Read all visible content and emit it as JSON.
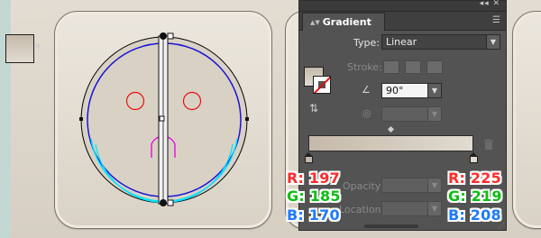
{
  "panel": {
    "title": "Gradient",
    "type_label": "Type:",
    "type_value": "Linear",
    "stroke_label": "Stroke:",
    "angle_value": "90°",
    "opacity_label": "Opacity:",
    "location_label": "Location:"
  },
  "gradient": {
    "start_color": "#c5b9aa",
    "end_color": "#e1dbd0"
  },
  "left_color": {
    "r_label": "R:",
    "r_value": "197",
    "g_label": "G:",
    "g_value": "185",
    "b_label": "B:",
    "b_value": "170"
  },
  "right_color": {
    "r_label": "R:",
    "r_value": "225",
    "g_label": "G:",
    "g_value": "219",
    "b_label": "B:",
    "b_value": "208"
  },
  "icons": {
    "collapse": "double-arrow-icon",
    "close": "close-icon",
    "menu": "panel-menu-icon",
    "angle": "angle-icon",
    "aspect": "aspect-ratio-icon",
    "reverse": "reverse-gradient-icon",
    "trash": "trash-icon"
  }
}
